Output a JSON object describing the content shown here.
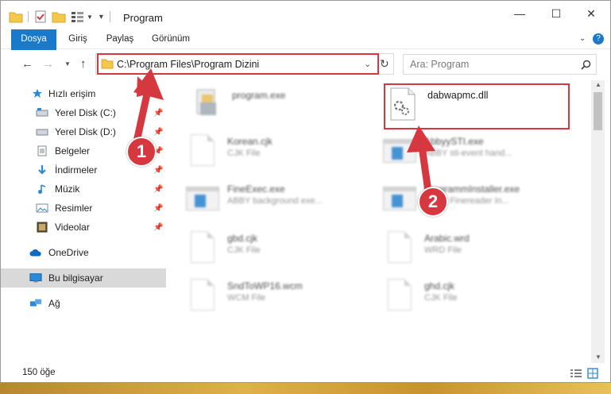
{
  "window": {
    "title": "Program",
    "controls": {
      "minimize": "—",
      "maximize": "☐",
      "close": "✕"
    }
  },
  "ribbon": {
    "tabs": [
      {
        "label": "Dosya",
        "active": true
      },
      {
        "label": "Giriş"
      },
      {
        "label": "Paylaş"
      },
      {
        "label": "Görünüm"
      }
    ],
    "help": "?"
  },
  "navigation": {
    "back": "←",
    "forward": "→",
    "up": "↑",
    "address": "C:\\Program Files\\Program Dizini",
    "search_placeholder": "Ara: Program"
  },
  "sidebar": {
    "items": [
      {
        "label": "Hızlı erişim",
        "icon": "star-icon",
        "pinned": false
      },
      {
        "label": "Yerel Disk (C:)",
        "icon": "drive-icon",
        "pinned": true
      },
      {
        "label": "Yerel Disk (D:)",
        "icon": "drive-icon",
        "pinned": true
      },
      {
        "label": "Belgeler",
        "icon": "documents-icon",
        "pinned": true
      },
      {
        "label": "İndirmeler",
        "icon": "download-icon",
        "pinned": true
      },
      {
        "label": "Müzik",
        "icon": "music-icon",
        "pinned": true
      },
      {
        "label": "Resimler",
        "icon": "pictures-icon",
        "pinned": true
      },
      {
        "label": "Videolar",
        "icon": "video-icon",
        "pinned": true
      },
      {
        "label": "OneDrive",
        "icon": "cloud-icon",
        "pinned": false
      },
      {
        "label": "Bu bilgisayar",
        "icon": "computer-icon",
        "pinned": false,
        "selected": true
      },
      {
        "label": "Ağ",
        "icon": "network-icon",
        "pinned": false
      }
    ]
  },
  "files": [
    {
      "name": "program.exe",
      "sub": "",
      "type": "installer",
      "blurred": true
    },
    {
      "name": "dabwapmc.dll",
      "sub": "",
      "type": "dll",
      "blurred": false,
      "highlighted": true
    },
    {
      "name": "Korean.cjk",
      "sub": "CJK File",
      "type": "doc",
      "blurred": true
    },
    {
      "name": "AbbyySTI.exe",
      "sub": "ABBY sti-event hand...",
      "type": "app",
      "blurred": true
    },
    {
      "name": "FineExec.exe",
      "sub": "ABBY background exe...",
      "type": "app",
      "blurred": true
    },
    {
      "name": "ProgrammInstaller.exe",
      "sub": "ABBY Finereader In...",
      "type": "app",
      "blurred": true
    },
    {
      "name": "gbd.cjk",
      "sub": "CJK File",
      "type": "doc",
      "blurred": true
    },
    {
      "name": "Arabic.wrd",
      "sub": "WRD File",
      "type": "doc",
      "blurred": true
    },
    {
      "name": "SndToWP16.wcm",
      "sub": "WCM File",
      "type": "doc",
      "blurred": true
    },
    {
      "name": "ghd.cjk",
      "sub": "CJK File",
      "type": "doc",
      "blurred": true
    }
  ],
  "status": {
    "item_count": "150 öğe"
  },
  "callouts": [
    {
      "label": "1"
    },
    {
      "label": "2"
    }
  ],
  "colors": {
    "accent": "#1979ca",
    "highlight": "#d6383f"
  }
}
